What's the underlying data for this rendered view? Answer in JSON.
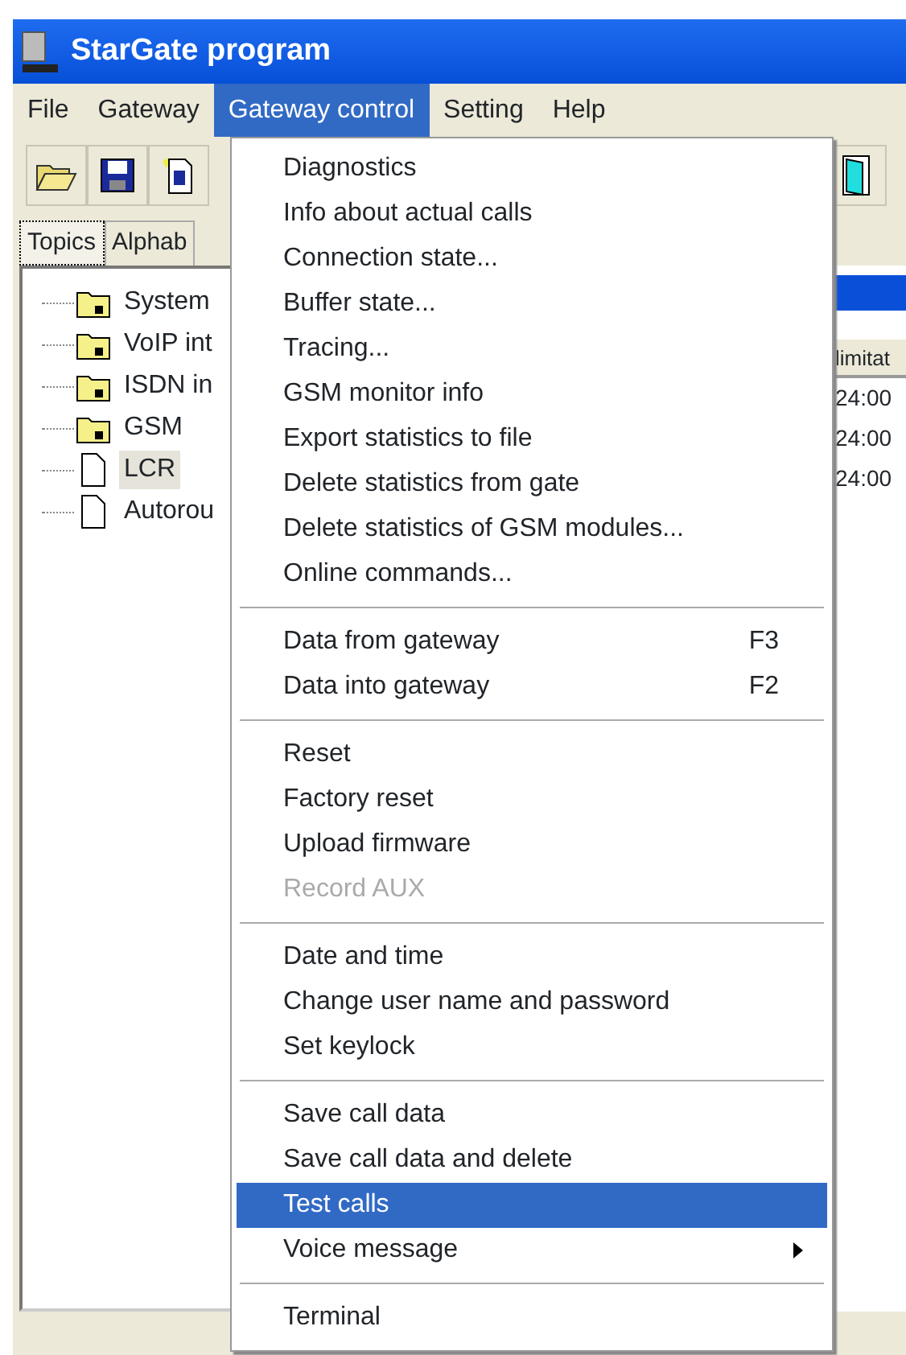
{
  "window": {
    "title": "StarGate program"
  },
  "menubar": [
    {
      "label": "File",
      "selected": false
    },
    {
      "label": "Gateway",
      "selected": false
    },
    {
      "label": "Gateway control",
      "selected": true
    },
    {
      "label": "Setting",
      "selected": false
    },
    {
      "label": "Help",
      "selected": false
    }
  ],
  "tabs": [
    {
      "label": "Topics",
      "selected": true
    },
    {
      "label": "Alphab",
      "selected": false
    }
  ],
  "tree": [
    {
      "label": "System",
      "kind": "folder",
      "selected": false
    },
    {
      "label": "VoIP int",
      "kind": "folder",
      "selected": false
    },
    {
      "label": "ISDN in",
      "kind": "folder",
      "selected": false
    },
    {
      "label": "GSM",
      "kind": "folder",
      "selected": false
    },
    {
      "label": "LCR",
      "kind": "file",
      "selected": true
    },
    {
      "label": "Autorou",
      "kind": "file",
      "selected": false
    }
  ],
  "table": {
    "columns": [
      "limitat"
    ],
    "rows": [
      [
        "24:00"
      ],
      [
        "24:00"
      ],
      [
        "24:00"
      ]
    ]
  },
  "menu": [
    {
      "kind": "item",
      "label": "Diagnostics",
      "selected": false,
      "disabled": false
    },
    {
      "kind": "item",
      "label": "Info about actual calls",
      "selected": false,
      "disabled": false
    },
    {
      "kind": "item",
      "label": "Connection state...",
      "selected": false,
      "disabled": false
    },
    {
      "kind": "item",
      "label": "Buffer state...",
      "selected": false,
      "disabled": false
    },
    {
      "kind": "item",
      "label": "Tracing...",
      "selected": false,
      "disabled": false
    },
    {
      "kind": "item",
      "label": "GSM monitor info",
      "selected": false,
      "disabled": false
    },
    {
      "kind": "item",
      "label": "Export statistics to file",
      "selected": false,
      "disabled": false
    },
    {
      "kind": "item",
      "label": "Delete statistics from gate",
      "selected": false,
      "disabled": false
    },
    {
      "kind": "item",
      "label": "Delete statistics of GSM modules...",
      "selected": false,
      "disabled": false
    },
    {
      "kind": "item",
      "label": "Online commands...",
      "selected": false,
      "disabled": false
    },
    {
      "kind": "separator"
    },
    {
      "kind": "item",
      "label": "Data from gateway",
      "shortcut": "F3",
      "selected": false,
      "disabled": false
    },
    {
      "kind": "item",
      "label": "Data into gateway",
      "shortcut": "F2",
      "selected": false,
      "disabled": false
    },
    {
      "kind": "separator"
    },
    {
      "kind": "item",
      "label": "Reset",
      "selected": false,
      "disabled": false
    },
    {
      "kind": "item",
      "label": "Factory reset",
      "selected": false,
      "disabled": false
    },
    {
      "kind": "item",
      "label": "Upload firmware",
      "selected": false,
      "disabled": false
    },
    {
      "kind": "item",
      "label": "Record AUX",
      "selected": false,
      "disabled": true
    },
    {
      "kind": "separator"
    },
    {
      "kind": "item",
      "label": "Date and time",
      "selected": false,
      "disabled": false
    },
    {
      "kind": "item",
      "label": "Change user name and password",
      "selected": false,
      "disabled": false
    },
    {
      "kind": "item",
      "label": "Set keylock",
      "selected": false,
      "disabled": false
    },
    {
      "kind": "separator"
    },
    {
      "kind": "item",
      "label": "Save call data",
      "selected": false,
      "disabled": false
    },
    {
      "kind": "item",
      "label": "Save call data and delete",
      "selected": false,
      "disabled": false
    },
    {
      "kind": "item",
      "label": "Test calls",
      "selected": true,
      "disabled": false
    },
    {
      "kind": "submenu",
      "label": "Voice message",
      "selected": false,
      "disabled": false
    },
    {
      "kind": "separator"
    },
    {
      "kind": "item",
      "label": "Terminal",
      "selected": false,
      "disabled": false
    }
  ]
}
